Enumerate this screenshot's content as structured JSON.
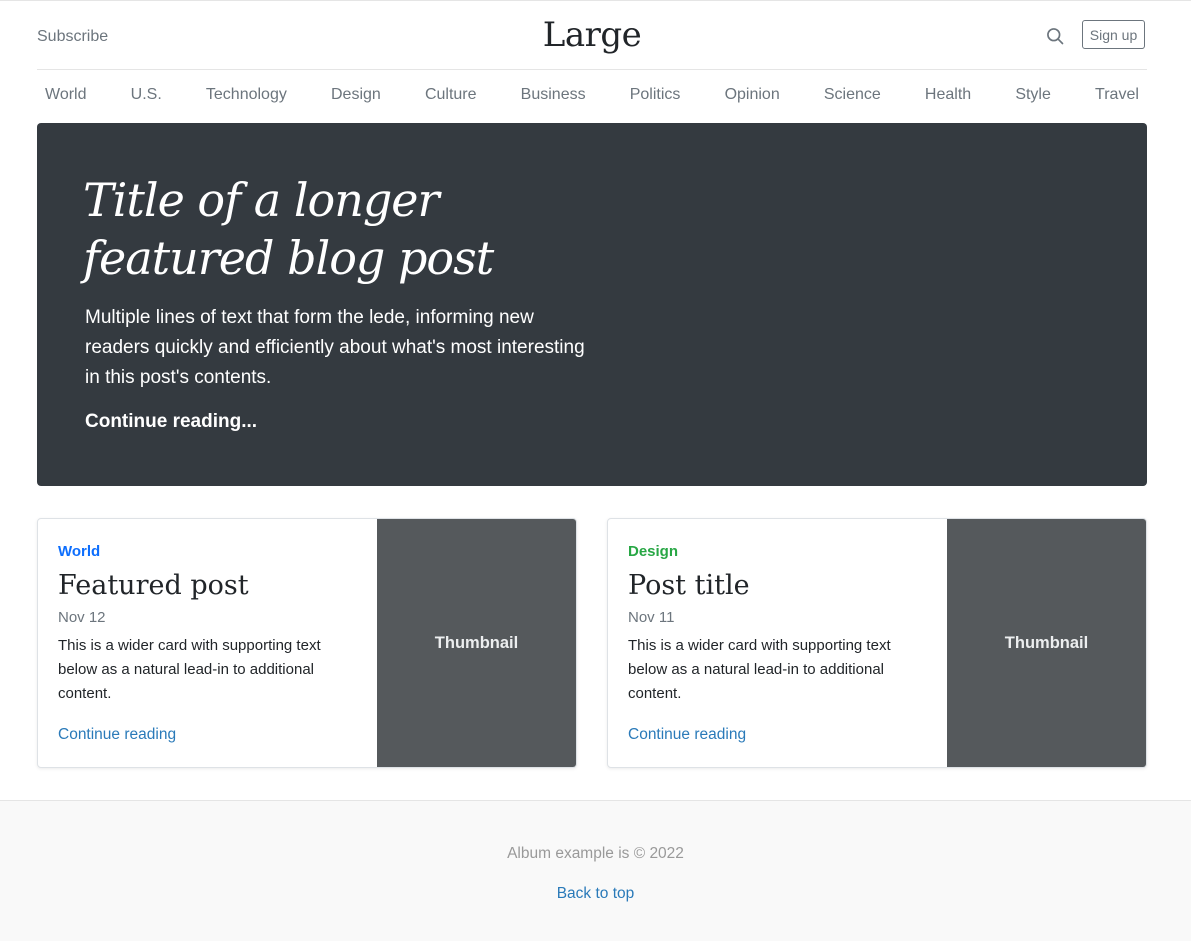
{
  "header": {
    "subscribe_label": "Subscribe",
    "logo": "Large",
    "search_icon": "search-icon",
    "signup_label": "Sign up"
  },
  "nav": {
    "items": [
      "World",
      "U.S.",
      "Technology",
      "Design",
      "Culture",
      "Business",
      "Politics",
      "Opinion",
      "Science",
      "Health",
      "Style",
      "Travel"
    ]
  },
  "hero": {
    "title": "Title of a longer featured blog post",
    "lede": "Multiple lines of text that form the lede, informing new readers quickly and efficiently about what's most interesting in this post's contents.",
    "link_label": "Continue reading..."
  },
  "cards": [
    {
      "category": "World",
      "category_color": "#0d6efd",
      "title": "Featured post",
      "date": "Nov 12",
      "text": "This is a wider card with supporting text below as a natural lead-in to additional content.",
      "link_label": "Continue reading",
      "thumbnail_label": "Thumbnail"
    },
    {
      "category": "Design",
      "category_color": "#28a745",
      "title": "Post title",
      "date": "Nov 11",
      "text": "This is a wider card with supporting text below as a natural lead-in to additional content.",
      "link_label": "Continue reading",
      "thumbnail_label": "Thumbnail"
    }
  ],
  "footer": {
    "text": "Album example is © 2022",
    "back_to_top_label": "Back to top"
  }
}
